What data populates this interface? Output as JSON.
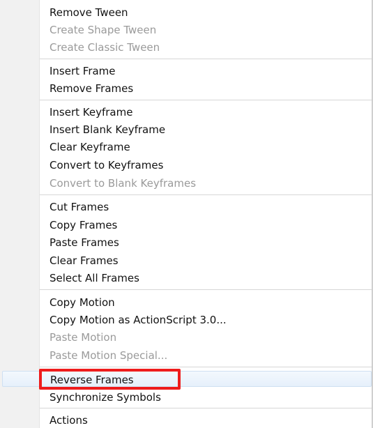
{
  "menu": {
    "items": [
      {
        "label": "Remove Tween",
        "disabled": false
      },
      {
        "label": "Create Shape Tween",
        "disabled": true
      },
      {
        "label": "Create Classic Tween",
        "disabled": true
      },
      {
        "label": "Insert Frame",
        "disabled": false
      },
      {
        "label": "Remove Frames",
        "disabled": false
      },
      {
        "label": "Insert Keyframe",
        "disabled": false
      },
      {
        "label": "Insert Blank Keyframe",
        "disabled": false
      },
      {
        "label": "Clear Keyframe",
        "disabled": false
      },
      {
        "label": "Convert to Keyframes",
        "disabled": false
      },
      {
        "label": "Convert to Blank Keyframes",
        "disabled": true
      },
      {
        "label": "Cut Frames",
        "disabled": false
      },
      {
        "label": "Copy Frames",
        "disabled": false
      },
      {
        "label": "Paste Frames",
        "disabled": false
      },
      {
        "label": "Clear Frames",
        "disabled": false
      },
      {
        "label": "Select All Frames",
        "disabled": false
      },
      {
        "label": "Copy Motion",
        "disabled": false
      },
      {
        "label": "Copy Motion as ActionScript 3.0...",
        "disabled": false
      },
      {
        "label": "Paste Motion",
        "disabled": true
      },
      {
        "label": "Paste Motion Special...",
        "disabled": true
      },
      {
        "label": "Reverse Frames",
        "disabled": false,
        "hovered": true,
        "annotated": true
      },
      {
        "label": "Synchronize Symbols",
        "disabled": false
      },
      {
        "label": "Actions",
        "disabled": false
      }
    ]
  },
  "colors": {
    "text": "#121212",
    "disabled_text": "#9a9a9a",
    "gutter": "#f1f1f1",
    "hover_highlight": "#e6f0fb",
    "annotation_outline": "#ee1c1c"
  }
}
